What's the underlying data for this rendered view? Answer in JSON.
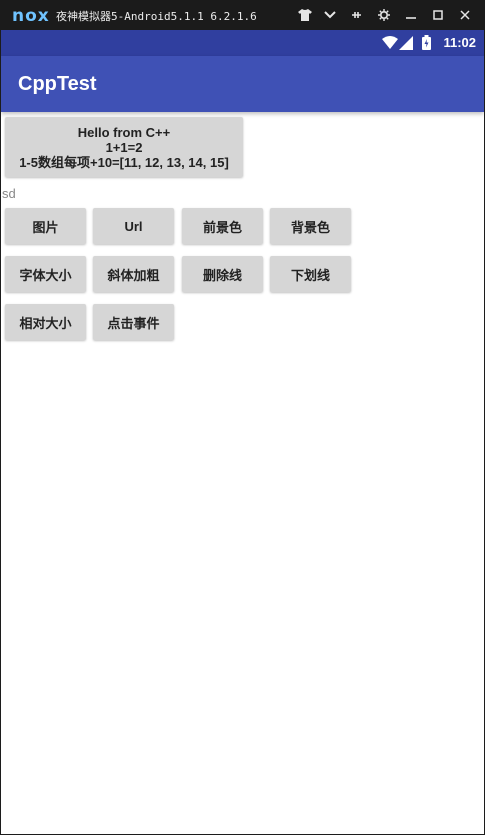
{
  "emulator": {
    "logo": "nox",
    "title": "夜神模拟器5-Android5.1.1 6.2.1.6",
    "controls": [
      "tshirt-icon",
      "chevron-down-icon",
      "pin-icon",
      "gear-icon",
      "minimize-icon",
      "maximize-icon",
      "close-icon"
    ]
  },
  "status_bar": {
    "time": "11:02",
    "color": "#303f9f"
  },
  "app_bar": {
    "title": "CppTest",
    "color": "#3f51b5"
  },
  "hello_button": {
    "line1": "Hello from C++",
    "line2": "1+1=2",
    "line3": "1-5数组每项+10=[11, 12, 13, 14, 15]"
  },
  "label": "sd",
  "buttons_row1": [
    "图片",
    "Url",
    "前景色",
    "背景色"
  ],
  "buttons_row2": [
    "字体大小",
    "斜体加粗",
    "删除线",
    "下划线"
  ],
  "buttons_row3": [
    "相对大小",
    "点击事件"
  ]
}
